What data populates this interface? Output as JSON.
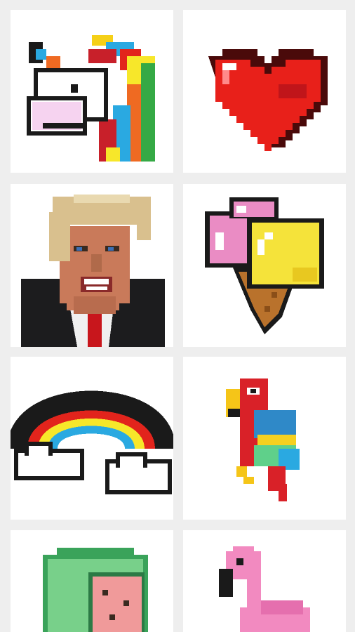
{
  "gallery": {
    "items": [
      {
        "id": "unicorn",
        "icon": "unicorn-icon"
      },
      {
        "id": "heart",
        "icon": "heart-icon"
      },
      {
        "id": "portrait",
        "icon": "portrait-icon"
      },
      {
        "id": "ice-cream",
        "icon": "ice-cream-icon"
      },
      {
        "id": "rainbow",
        "icon": "rainbow-icon"
      },
      {
        "id": "parrot",
        "icon": "parrot-icon"
      },
      {
        "id": "watermelon",
        "icon": "watermelon-icon"
      },
      {
        "id": "flamingo",
        "icon": "flamingo-icon"
      }
    ]
  },
  "colors": {
    "background": "#eeeeee",
    "card": "#ffffff",
    "outline": "#1a1a1a",
    "heart_red": "#e8201a",
    "rainbow_red": "#e2241c",
    "rainbow_yellow": "#f7e72a",
    "rainbow_blue": "#2aa9e1",
    "icecream_pink": "#ea8cc4",
    "icecream_yellow": "#f5e33a",
    "cone": "#b9722c",
    "parrot_red": "#d92128",
    "flamingo_pink": "#f28ac0",
    "watermelon_green": "#78d08a"
  }
}
